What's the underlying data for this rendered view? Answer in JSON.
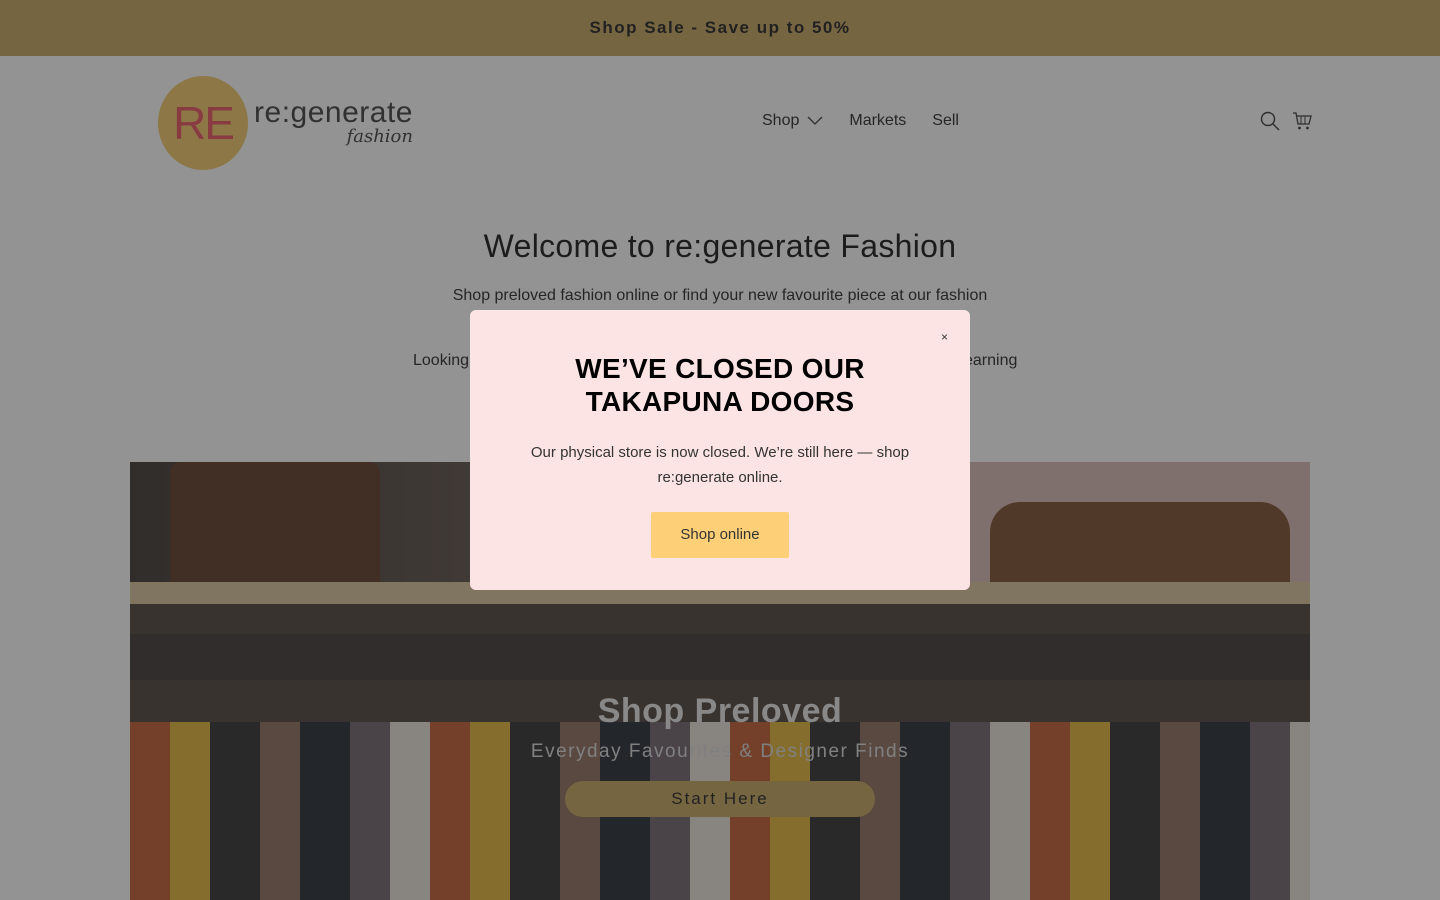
{
  "announcement": {
    "text": "Shop Sale - Save up to 50%"
  },
  "header": {
    "logo": {
      "mark": "RE",
      "name": "re:generate",
      "tagline": "fashion"
    },
    "nav": [
      {
        "label": "Shop",
        "has_dropdown": true
      },
      {
        "label": "Markets"
      },
      {
        "label": "Sell"
      }
    ],
    "icons": [
      "search-icon",
      "cart-icon"
    ]
  },
  "intro": {
    "title": "Welcome to re:generate Fashion",
    "line1": "Shop preloved fashion online or find your new favourite piece at our fashion",
    "line2_left": "Looking",
    "line2_right": "earning"
  },
  "hero": {
    "title": "Shop Preloved",
    "subtitle": "Everyday Favourites & Designer Finds",
    "button": "Start Here"
  },
  "modal": {
    "title_line1": "WE’VE CLOSED OUR",
    "title_line2": "TAKAPUNA DOORS",
    "message": "Our physical store is now closed. We’re still here — shop re:generate online.",
    "button": "Shop online",
    "close": "×"
  },
  "colors": {
    "announcement_bg": "#c4a35a",
    "modal_bg": "#fde4e4",
    "modal_button": "#fdd077",
    "hero_button": "#c4a35a",
    "logo_circle": "#f2c766",
    "logo_mark": "#e8505b"
  }
}
